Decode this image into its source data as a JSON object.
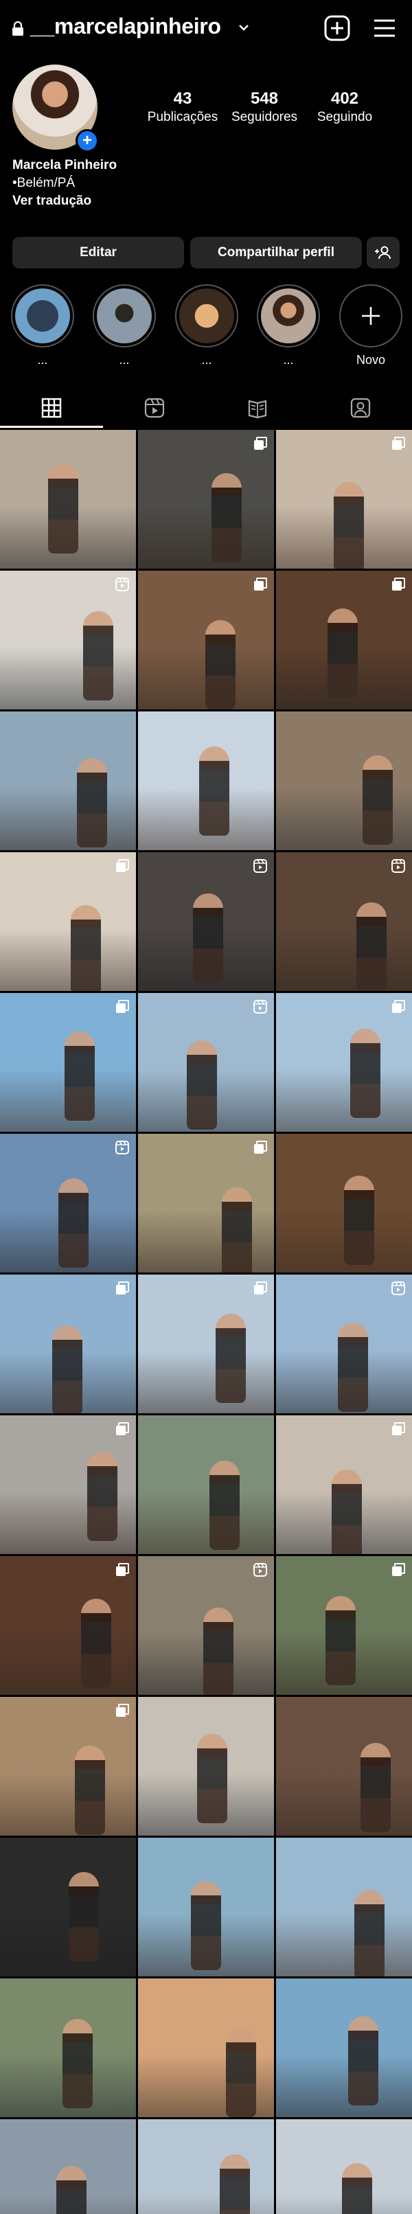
{
  "header": {
    "username": "__marcelapinheiro",
    "icons": [
      "lock-icon",
      "chevron-down-icon",
      "new-post-icon",
      "menu-icon"
    ]
  },
  "profile": {
    "posts_count": "43",
    "posts_label": "Publicações",
    "followers_count": "548",
    "followers_label": "Seguidores",
    "following_count": "402",
    "following_label": "Seguindo",
    "name": "Marcela Pinheiro",
    "location": "•Belém/PÁ",
    "translate": "Ver tradução"
  },
  "actions": {
    "edit_label": "Editar",
    "share_label": "Compartilhar perfil"
  },
  "highlights": [
    {
      "label": "...",
      "color": "#6fa0c8"
    },
    {
      "label": "...",
      "color": "#8a9aa8"
    },
    {
      "label": "...",
      "color": "#c58a5a"
    },
    {
      "label": "...",
      "color": "#b7a79a"
    },
    {
      "label": "Novo"
    }
  ],
  "tabs": [
    "grid-icon",
    "reels-icon",
    "guides-icon",
    "tagged-icon"
  ],
  "grid": [
    {
      "bg": "#b6a99a",
      "badge": ""
    },
    {
      "bg": "#4d4c48",
      "badge": "carousel"
    },
    {
      "bg": "#c7b8a8",
      "badge": "carousel"
    },
    {
      "bg": "#d8d3cc",
      "badge": "reel"
    },
    {
      "bg": "#7a5a42",
      "badge": "carousel"
    },
    {
      "bg": "#5c3f2c",
      "badge": "carousel"
    },
    {
      "bg": "#8fa7b9",
      "badge": ""
    },
    {
      "bg": "#c8d4e0",
      "badge": ""
    },
    {
      "bg": "#8d7a66",
      "badge": ""
    },
    {
      "bg": "#d9cfc2",
      "badge": "carousel"
    },
    {
      "bg": "#4a4442",
      "badge": "reel"
    },
    {
      "bg": "#5a4536",
      "badge": "reel"
    },
    {
      "bg": "#7fb0d6",
      "badge": "carousel"
    },
    {
      "bg": "#9fbad0",
      "badge": "reel"
    },
    {
      "bg": "#a7c3d9",
      "badge": "carousel"
    },
    {
      "bg": "#6d8fb4",
      "badge": "reel"
    },
    {
      "bg": "#a4987a",
      "badge": "carousel"
    },
    {
      "bg": "#6a4a30",
      "badge": ""
    },
    {
      "bg": "#8fb1d0",
      "badge": "carousel"
    },
    {
      "bg": "#b8c9d8",
      "badge": "carousel"
    },
    {
      "bg": "#9ab8d4",
      "badge": "reel"
    },
    {
      "bg": "#a9a5a0",
      "badge": "carousel"
    },
    {
      "bg": "#7d8f7a",
      "badge": ""
    },
    {
      "bg": "#c7bdb0",
      "badge": "carousel"
    },
    {
      "bg": "#5a3a2a",
      "badge": "carousel"
    },
    {
      "bg": "#8a8070",
      "badge": "reel"
    },
    {
      "bg": "#6a7a5a",
      "badge": "carousel"
    },
    {
      "bg": "#a78a6a",
      "badge": "carousel"
    },
    {
      "bg": "#c7c0b6",
      "badge": ""
    },
    {
      "bg": "#6a5040",
      "badge": ""
    },
    {
      "bg": "#2a2a2a",
      "badge": ""
    },
    {
      "bg": "#8ab0c8",
      "badge": ""
    },
    {
      "bg": "#9ab8cf",
      "badge": ""
    },
    {
      "bg": "#7a8a6a",
      "badge": ""
    },
    {
      "bg": "#d6a47a",
      "badge": ""
    },
    {
      "bg": "#7aa6c8",
      "badge": ""
    },
    {
      "bg": "#8c9aa8",
      "badge": ""
    },
    {
      "bg": "#b7c6d4",
      "badge": ""
    },
    {
      "bg": "#c6cfd6",
      "badge": ""
    }
  ]
}
